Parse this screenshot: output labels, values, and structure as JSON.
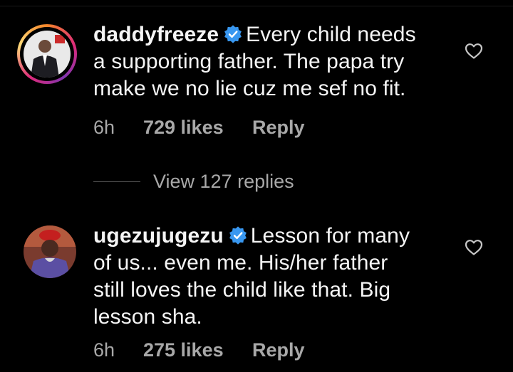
{
  "colors": {
    "background": "#000000",
    "text_primary": "#f5f5f5",
    "text_secondary": "#a8a8a8",
    "verified_blue": "#3897f0"
  },
  "comments": [
    {
      "username": "daddyfreeze",
      "verified": true,
      "avatar_story_ring": true,
      "text_line1": "Every child needs",
      "text_line2": "a supporting father. The papa try",
      "text_line3": "make we no lie cuz me sef no fit.",
      "time": "6h",
      "likes": "729 likes",
      "reply_label": "Reply",
      "icons": [
        "verified-badge-icon",
        "heart-outline-icon"
      ]
    },
    {
      "username": "ugezujugezu",
      "verified": true,
      "avatar_story_ring": false,
      "text_line1": "Lesson for many",
      "text_line2": "of us... even me. His/her father",
      "text_line3": "still loves the child like that. Big",
      "text_line4": "lesson sha.",
      "time": "6h",
      "likes": "275 likes",
      "reply_label": "Reply",
      "icons": [
        "verified-badge-icon",
        "heart-outline-icon"
      ]
    }
  ],
  "view_replies": "View 127 replies"
}
